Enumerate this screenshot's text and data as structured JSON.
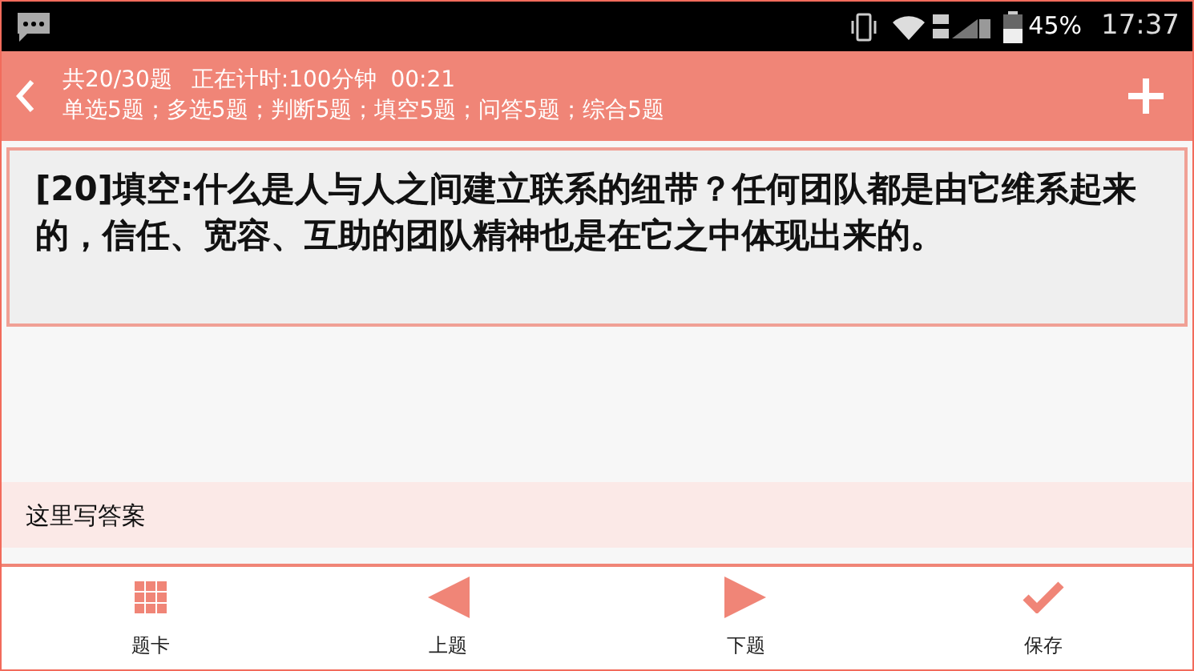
{
  "status_bar": {
    "battery": "45%",
    "time": "17:37"
  },
  "header": {
    "progress": "共20/30题",
    "timer": "正在计时:100分钟  00:21",
    "summary": "单选5题；多选5题；判断5题；填空5题；问答5题；综合5题"
  },
  "question": {
    "text": "[20]填空:什么是人与人之间建立联系的纽带？任何团队都是由它维系起来的，信任、宽容、互助的团队精神也是在它之中体现出来的。"
  },
  "answer": {
    "placeholder": "这里写答案"
  },
  "toolbar": [
    {
      "kind": "grid",
      "label": "题卡"
    },
    {
      "kind": "prev",
      "label": "上题"
    },
    {
      "kind": "next",
      "label": "下题"
    },
    {
      "kind": "check",
      "label": "保存"
    }
  ]
}
